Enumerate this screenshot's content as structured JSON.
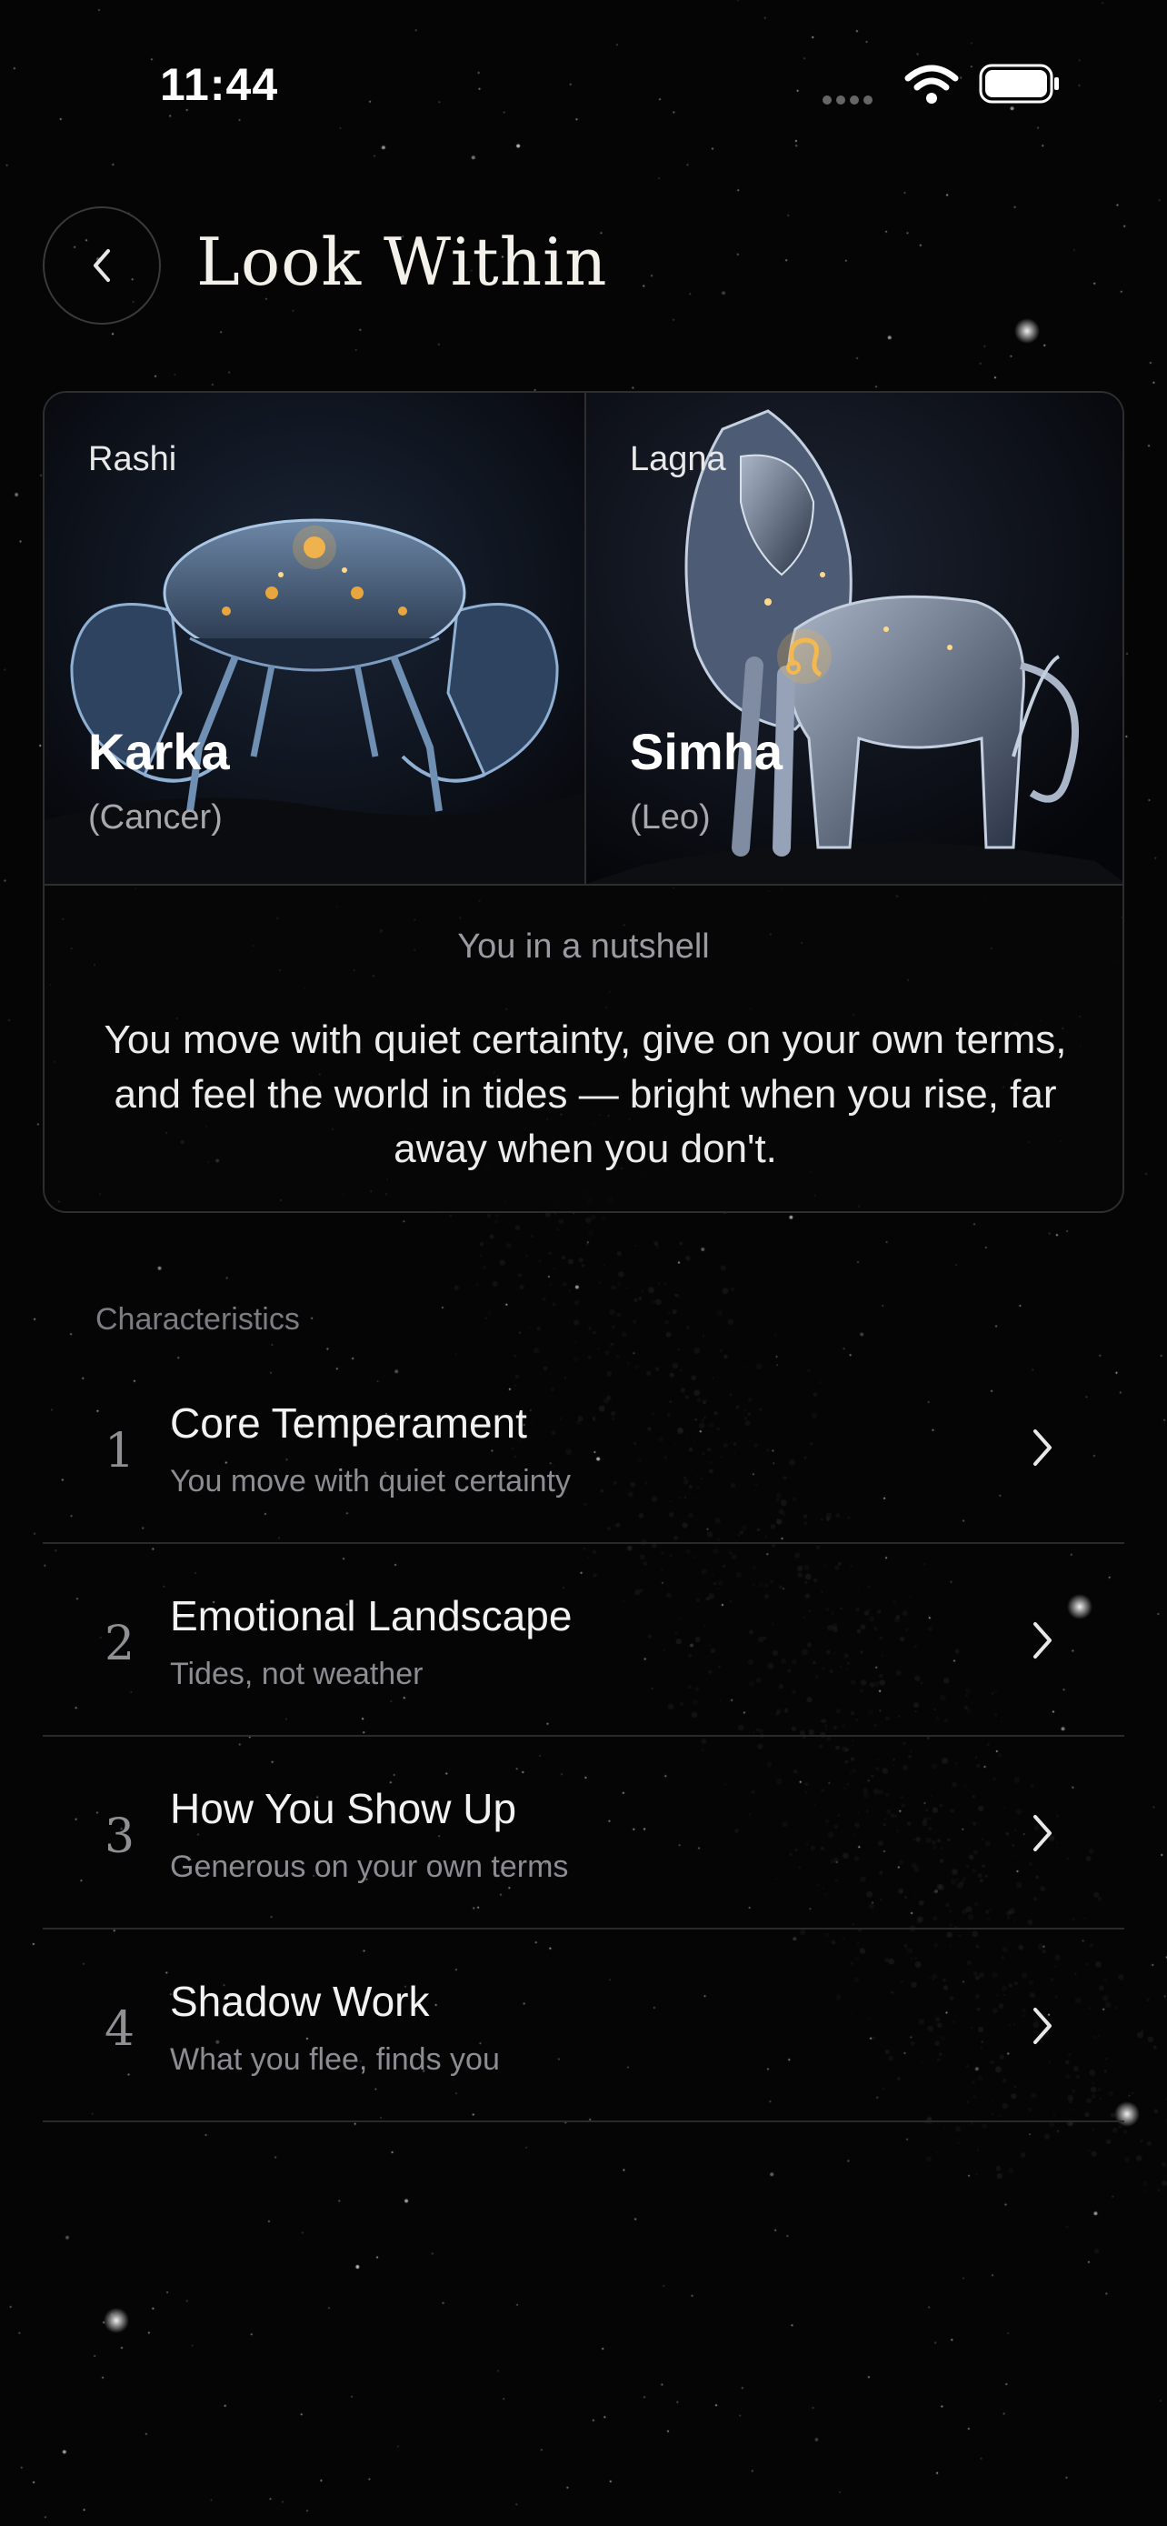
{
  "status_bar": {
    "time": "11:44"
  },
  "header": {
    "title": "Look Within"
  },
  "signs": [
    {
      "kicker": "Rashi",
      "name": "Karka",
      "sub": "(Cancer)",
      "icon": "crab-illustration"
    },
    {
      "kicker": "Lagna",
      "name": "Simha",
      "sub": "(Leo)",
      "icon": "lion-illustration"
    }
  ],
  "nutshell": {
    "label": "You in a nutshell",
    "text": "You move with quiet certainty, give on your own terms, and feel the world in tides — bright when you rise, far away when you don't."
  },
  "characteristics": {
    "label": "Characteristics",
    "items": [
      {
        "num": "1",
        "title": "Core Temperament",
        "subtitle": "You move with quiet certainty"
      },
      {
        "num": "2",
        "title": "Emotional Landscape",
        "subtitle": "Tides, not weather"
      },
      {
        "num": "3",
        "title": "How You Show Up",
        "subtitle": "Generous on your own terms"
      },
      {
        "num": "4",
        "title": "Shadow Work",
        "subtitle": "What you flee, finds you"
      }
    ]
  },
  "colors": {
    "background": "#050506",
    "accent_gold": "#e0a948",
    "card_border": "#2e2e31"
  }
}
